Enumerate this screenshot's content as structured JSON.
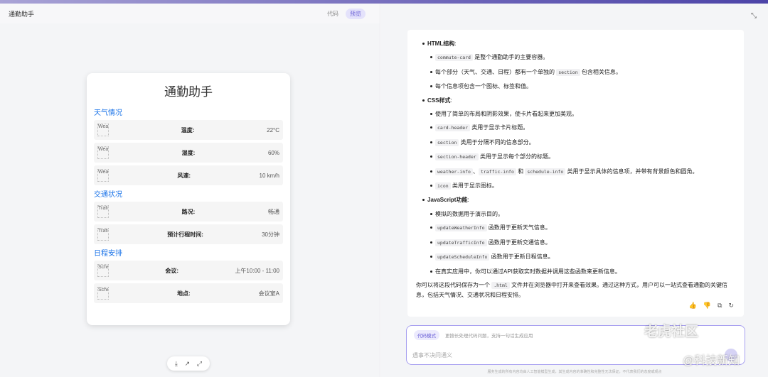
{
  "left_panel": {
    "title": "通勤助手",
    "tabs": [
      {
        "label": "代码",
        "active": false
      },
      {
        "label": "预览",
        "active": true
      }
    ]
  },
  "card": {
    "title": "通勤助手",
    "sections": [
      {
        "title": "天气情况",
        "rows": [
          {
            "icon_alt": "Wea",
            "label": "温度:",
            "value": "22°C"
          },
          {
            "icon_alt": "Wea",
            "label": "湿度:",
            "value": "60%"
          },
          {
            "icon_alt": "Wea",
            "label": "风速:",
            "value": "10 km/h"
          }
        ]
      },
      {
        "title": "交通状况",
        "rows": [
          {
            "icon_alt": "Trafi",
            "label": "路况:",
            "value": "畅通"
          },
          {
            "icon_alt": "Trafi",
            "label": "预计行程时间:",
            "value": "30分钟"
          }
        ]
      },
      {
        "title": "日程安排",
        "rows": [
          {
            "icon_alt": "Sche",
            "label": "会议:",
            "value": "上午10:00 - 11:00"
          },
          {
            "icon_alt": "Sche",
            "label": "地点:",
            "value": "会议室A"
          }
        ]
      }
    ]
  },
  "preview_tools": [
    "download-icon",
    "share-icon",
    "fullscreen-icon"
  ],
  "message": {
    "html_heading": "HTML结构",
    "html_items": [
      {
        "code": "commute-card",
        "text": " 是整个通勤助手的主要容器。"
      },
      {
        "pre": "每个部分（天气、交通、日程）都有一个单独的 ",
        "code": "section",
        "text": " 包含相关信息。"
      },
      {
        "text": "每个信息项包含一个图标、标签和值。"
      }
    ],
    "css_heading": "CSS样式",
    "css_items": [
      {
        "text": "使用了简单的布局和阴影效果，使卡片看起来更加美观。"
      },
      {
        "code": "card-header",
        "text": " 类用于显示卡片标题。"
      },
      {
        "code": "section",
        "text": " 类用于分隔不同的信息部分。"
      },
      {
        "code": "section-header",
        "text": " 类用于显示每个部分的标题。"
      },
      {
        "code": "weather-info",
        "code2": "traffic-info",
        "code3": "schedule-info",
        "text": " 类用于显示具体的信息项，并带有背景颜色和圆角。"
      },
      {
        "code": "icon",
        "text": " 类用于显示图标。"
      }
    ],
    "js_heading": "JavaScript功能",
    "js_items": [
      {
        "text": "模拟的数据用于演示目的。"
      },
      {
        "code": "updateWeatherInfo",
        "text": " 函数用于更新天气信息。"
      },
      {
        "code": "updateTrafficInfo",
        "text": " 函数用于更新交通信息。"
      },
      {
        "code": "updateScheduleInfo",
        "text": " 函数用于更新日程信息。"
      },
      {
        "text": "在真实应用中，你可以通过API获取实时数据并调用这些函数来更新信息。"
      }
    ],
    "closing_pre": "你可以将这段代码保存为一个 ",
    "closing_code": ".html",
    "closing_post": " 文件并在浏览器中打开来查看效果。通过这种方式，用户可以一站式查看通勤的关键信息，包括天气情况、交通状况和日程安排。",
    "actions": [
      "thumb-up-icon",
      "thumb-down-icon",
      "copy-icon",
      "regenerate-icon"
    ]
  },
  "input": {
    "mode_chip": "代码模式",
    "mode_hint": "更擅长处理代码问题，支持一句话生成应用",
    "placeholder": "遇事不决问通义"
  },
  "disclaimer": "服务生成的所有内容均由人工智能模型生成，其生成内容的准确性和完整性无法保证，不代表我们的态度或观点",
  "watermark": {
    "line1": "老虎社区",
    "line2": "@科技新知"
  },
  "colors": {
    "accent": "#6a5fd6",
    "section_title": "#1a73e8",
    "input_border": "#a79ff0"
  }
}
